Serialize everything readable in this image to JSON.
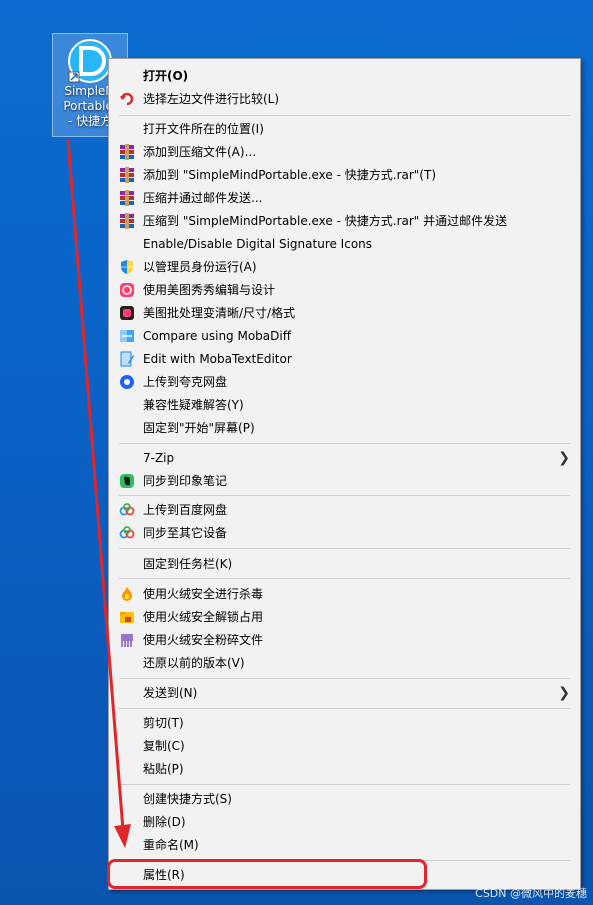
{
  "desktop": {
    "icon_label_line1": "SimpleM",
    "icon_label_line2": "Portable.",
    "icon_label_line3": "- 快捷方"
  },
  "menu": {
    "items": [
      {
        "label": "打开(O)",
        "icon": "none",
        "bold": true
      },
      {
        "label": "选择左边文件进行比较(L)",
        "icon": "undo-arrow-icon"
      },
      {
        "label": "打开文件所在的位置(I)",
        "icon": "none"
      },
      {
        "label": "添加到压缩文件(A)...",
        "icon": "winrar-icon"
      },
      {
        "label": "添加到 \"SimpleMindPortable.exe - 快捷方式.rar\"(T)",
        "icon": "winrar-icon"
      },
      {
        "label": "压缩并通过邮件发送...",
        "icon": "winrar-icon"
      },
      {
        "label": "压缩到 \"SimpleMindPortable.exe - 快捷方式.rar\" 并通过邮件发送",
        "icon": "winrar-icon"
      },
      {
        "label": "Enable/Disable Digital Signature Icons",
        "icon": "none"
      },
      {
        "label": "以管理员身份运行(A)",
        "icon": "shield-icon"
      },
      {
        "label": "使用美图秀秀编辑与设计",
        "icon": "meitu-icon"
      },
      {
        "label": "美图批处理变清晰/尺寸/格式",
        "icon": "meitu-batch-icon"
      },
      {
        "label": "Compare using MobaDiff",
        "icon": "mobadiff-icon"
      },
      {
        "label": "Edit with MobaTextEditor",
        "icon": "mobatext-icon"
      },
      {
        "label": "上传到夸克网盘",
        "icon": "quark-icon"
      },
      {
        "label": "兼容性疑难解答(Y)",
        "icon": "none"
      },
      {
        "label": "固定到\"开始\"屏幕(P)",
        "icon": "none"
      },
      {
        "label": "7-Zip",
        "icon": "none",
        "submenu": true
      },
      {
        "label": "同步到印象笔记",
        "icon": "evernote-icon"
      },
      {
        "label": "上传到百度网盘",
        "icon": "baidu-icon"
      },
      {
        "label": "同步至其它设备",
        "icon": "baidu-icon"
      },
      {
        "label": "固定到任务栏(K)",
        "icon": "none"
      },
      {
        "label": "使用火绒安全进行杀毒",
        "icon": "huorong-icon"
      },
      {
        "label": "使用火绒安全解锁占用",
        "icon": "huorong-unlock-icon"
      },
      {
        "label": "使用火绒安全粉碎文件",
        "icon": "huorong-shred-icon"
      },
      {
        "label": "还原以前的版本(V)",
        "icon": "none"
      },
      {
        "label": "发送到(N)",
        "icon": "none",
        "submenu": true
      },
      {
        "label": "剪切(T)",
        "icon": "none"
      },
      {
        "label": "复制(C)",
        "icon": "none"
      },
      {
        "label": "粘贴(P)",
        "icon": "none"
      },
      {
        "label": "创建快捷方式(S)",
        "icon": "none"
      },
      {
        "label": "删除(D)",
        "icon": "none"
      },
      {
        "label": "重命名(M)",
        "icon": "none"
      },
      {
        "label": "属性(R)",
        "icon": "none"
      }
    ]
  },
  "watermark": "CSDN @微风中的麦穗",
  "colors": {
    "desktop": "#0a63c7",
    "menu_bg": "#f2f2f2",
    "highlight_red": "#e0262a"
  }
}
